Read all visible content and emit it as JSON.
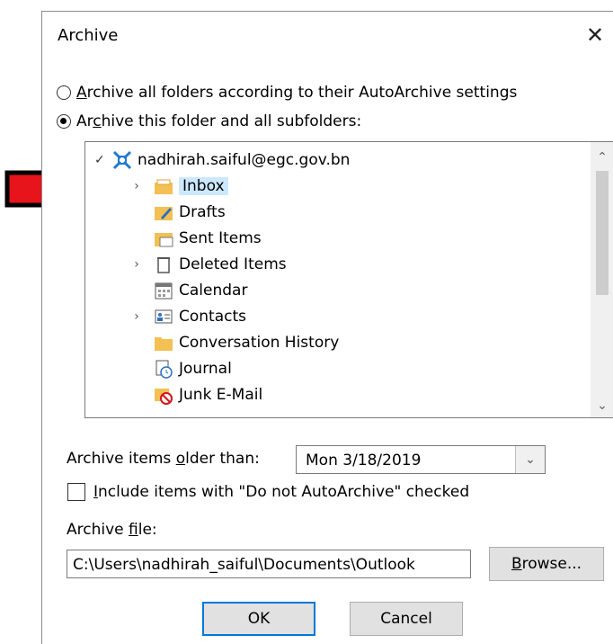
{
  "dialog": {
    "title": "Archive",
    "close_glyph": "✕"
  },
  "radios": {
    "all_prefix": "",
    "all_accel": "A",
    "all_rest": "rchive all folders according to their AutoArchive settings",
    "this_prefix": "Ar",
    "this_accel": "c",
    "this_rest": "hive this folder and all subfolders:"
  },
  "tree": {
    "account": "nadhirah.saiful@egc.gov.bn",
    "folders": [
      {
        "label": "Inbox",
        "selected": true,
        "expandable": true
      },
      {
        "label": "Drafts",
        "selected": false,
        "expandable": false
      },
      {
        "label": "Sent Items",
        "selected": false,
        "expandable": false
      },
      {
        "label": "Deleted Items",
        "selected": false,
        "expandable": true
      },
      {
        "label": "Calendar",
        "selected": false,
        "expandable": false
      },
      {
        "label": "Contacts",
        "selected": false,
        "expandable": true
      },
      {
        "label": "Conversation History",
        "selected": false,
        "expandable": false
      },
      {
        "label": "Journal",
        "selected": false,
        "expandable": false
      },
      {
        "label": "Junk E-Mail",
        "selected": false,
        "expandable": false
      }
    ]
  },
  "older": {
    "label_prefix": "Archive items ",
    "label_accel": "o",
    "label_rest": "lder than:",
    "value": "Mon 3/18/2019"
  },
  "include": {
    "accel": "I",
    "rest": "nclude items with \"Do not AutoArchive\" checked"
  },
  "file": {
    "label_prefix": "Archive ",
    "label_accel": "f",
    "label_rest": "ile:",
    "value": "C:\\Users\\nadhirah_saiful\\Documents\\Outlook"
  },
  "buttons": {
    "browse_accel": "B",
    "browse_rest": "rowse...",
    "ok": "OK",
    "cancel": "Cancel"
  },
  "colors": {
    "arrow": "#e8141c",
    "selected_bg": "#cce8ff",
    "default_button_border": "#0078d7"
  }
}
